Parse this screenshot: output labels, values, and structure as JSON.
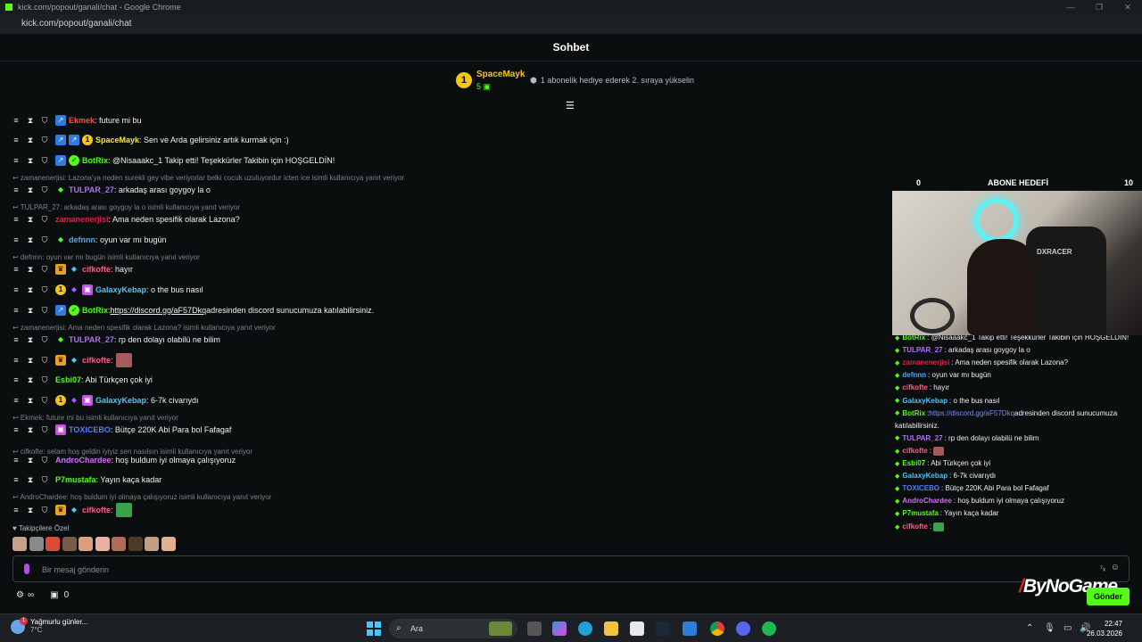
{
  "browser": {
    "title": "kick.com/popout/ganali/chat - Google Chrome",
    "url": "kick.com/popout/ganali/chat"
  },
  "header": {
    "title": "Sohbet"
  },
  "pinned": {
    "badge": "1",
    "username": "SpaceMayk",
    "count": "5",
    "text": "1 abonelik hediye ederek 2. sıraya yükselin"
  },
  "chat": {
    "messages": [
      {
        "user": "Ekmek",
        "color": "#ff4d4d",
        "text": ": future mi bu"
      },
      {
        "user": "SpaceMayk",
        "color": "#f5e642",
        "text": ": Sen ve Arda gelirsiniz artık kurmak için :)"
      },
      {
        "user": "BotRix",
        "color": "#53fc18",
        "text": ": @Nisaaakc_1 Takip etti! Teşekkürler Takibin için HOŞGELDİN!"
      },
      {
        "reply": "zamanenerjisi: Lazona'ya neden surekli gey vibe veriyorlar belki cocuk uzuluyordur icten ice isimli kullanıcıya yanıt veriyor"
      },
      {
        "user": "TULPAR_27",
        "color": "#b26cff",
        "text": ": arkadaş arası goygoy la o"
      },
      {
        "reply": "TULPAR_27: arkadaş arası goygoy la o isimli kullanıcıya yanıt veriyor"
      },
      {
        "user": "zamanenerjisi",
        "color": "#d4264a",
        "text": ": Ama neden spesifik olarak Lazona?"
      },
      {
        "user": "defnnn",
        "color": "#4fa3ff",
        "text": ": oyun var mı bugün"
      },
      {
        "reply": "defnnn: oyun var mı bugün isimli kullanıcıya yanıt veriyor"
      },
      {
        "user": "cifkofte",
        "color": "#ff5a8a",
        "text": ": hayır"
      },
      {
        "user": "GalaxyKebap",
        "color": "#4fc3f7",
        "text": ": o the bus nasıl"
      },
      {
        "user": "BotRix",
        "color": "#53fc18",
        "link": "https://discord.gg/aF57Dkq",
        "text": " adresinden discord sunucumuza katılabilirsiniz."
      },
      {
        "reply": "zamanenerjisi: Ama neden spesifik olarak Lazona? isimli kullanıcıya yanıt veriyor"
      },
      {
        "user": "TULPAR_27",
        "color": "#b26cff",
        "text": ": rp den dolayı olabilü ne bilim"
      },
      {
        "user": "cifkofte",
        "color": "#ff5a8a",
        "text": ":"
      },
      {
        "user": "Esbi07",
        "color": "#53fc18",
        "text": ": Abi Türkçen çok iyi"
      },
      {
        "user": "GalaxyKebap",
        "color": "#4fc3f7",
        "text": ": 6-7k civarıydı"
      },
      {
        "reply": "Ekmek: future mi bu isimli kullanıcıya yanıt veriyor"
      },
      {
        "user": "TOXICEBO",
        "color": "#4f7dff",
        "text": ": Bütçe 220K Abi Para bol Fafagaf"
      },
      {
        "reply": "cifkofte: selam hoş geldin iyiyiz sen nasılsın isimli kullanıcıya yanıt veriyor"
      },
      {
        "user": "AndroChardee",
        "color": "#d46cff",
        "text": ": hoş buldum iyi olmaya çalışıyoruz"
      },
      {
        "user": "P7mustafa",
        "color": "#53fc18",
        "text": ": Yayın kaça kadar"
      },
      {
        "reply": "AndroChardee: hoş buldum iyi olmaya çalışıyoruz isimli kullanıcıya yanıt veriyor"
      },
      {
        "user": "cifkofte",
        "color": "#ff5a8a",
        "text": ":"
      }
    ]
  },
  "followers_label": "Takipçilere Özel",
  "input": {
    "placeholder": "Bir mesaj gönderin"
  },
  "bottom": {
    "infinity": "∞",
    "count": "0",
    "send": "Gönder"
  },
  "overlay": {
    "goal_left": "0",
    "goal_title": "ABONE HEDEFİ",
    "goal_right": "10",
    "cam_logo": "DXRACER",
    "mini_chat": [
      {
        "user": "BotRix",
        "color": "#53fc18",
        "text": " : @Nisaaakc_1 Takip etti! Teşekkürler Takibin için HOŞGELDİN!"
      },
      {
        "user": "TULPAR_27",
        "color": "#b26cff",
        "text": " : arkadaş arası goygoy la o"
      },
      {
        "user": "zamanenerjisi",
        "color": "#d4264a",
        "text": " : Ama neden spesifik olarak Lazona?"
      },
      {
        "user": "defnnn",
        "color": "#4fa3ff",
        "text": " : oyun var mı bugün"
      },
      {
        "user": "cifkofte",
        "color": "#ff5a8a",
        "text": " : hayır"
      },
      {
        "user": "GalaxyKebap",
        "color": "#4fc3f7",
        "text": " : o the bus nasıl"
      },
      {
        "user": "BotRix",
        "color": "#53fc18",
        "link": "https://discord.gg/aF57Dkq",
        "text": " adresinden discord sunucumuza"
      },
      {
        "cont": "katılabilirsiniz."
      },
      {
        "user": "TULPAR_27",
        "color": "#b26cff",
        "text": " : rp den dolayı olabilü ne bilim"
      },
      {
        "user": "cifkofte",
        "color": "#ff5a8a",
        "text": " :"
      },
      {
        "user": "Esbi07",
        "color": "#53fc18",
        "text": " : Abi Türkçen çok iyi"
      },
      {
        "user": "GalaxyKebap",
        "color": "#4fc3f7",
        "text": " : 6-7k civarıydı"
      },
      {
        "user": "TOXICEBO",
        "color": "#4f7dff",
        "text": " : Bütçe 220K Abi Para bol Fafagaf"
      },
      {
        "user": "AndroChardee",
        "color": "#d46cff",
        "text": " : hoş buldum iyi olmaya çalışıyoruz"
      },
      {
        "user": "P7mustafa",
        "color": "#53fc18",
        "text": " : Yayın kaça kadar"
      },
      {
        "user": "cifkofte",
        "color": "#ff5a8a",
        "text": " :"
      }
    ],
    "watermark": "ByNoGame"
  },
  "taskbar": {
    "weather": "Yağmurlu günler...",
    "temp": "7°C",
    "weather_badge": "1",
    "search": "Ara",
    "time": "22:47",
    "date": "26.03.2026"
  },
  "colors": {
    "accent": "#53fc18",
    "background": "#0b0e0f",
    "sub_badge": "#f5c518"
  }
}
